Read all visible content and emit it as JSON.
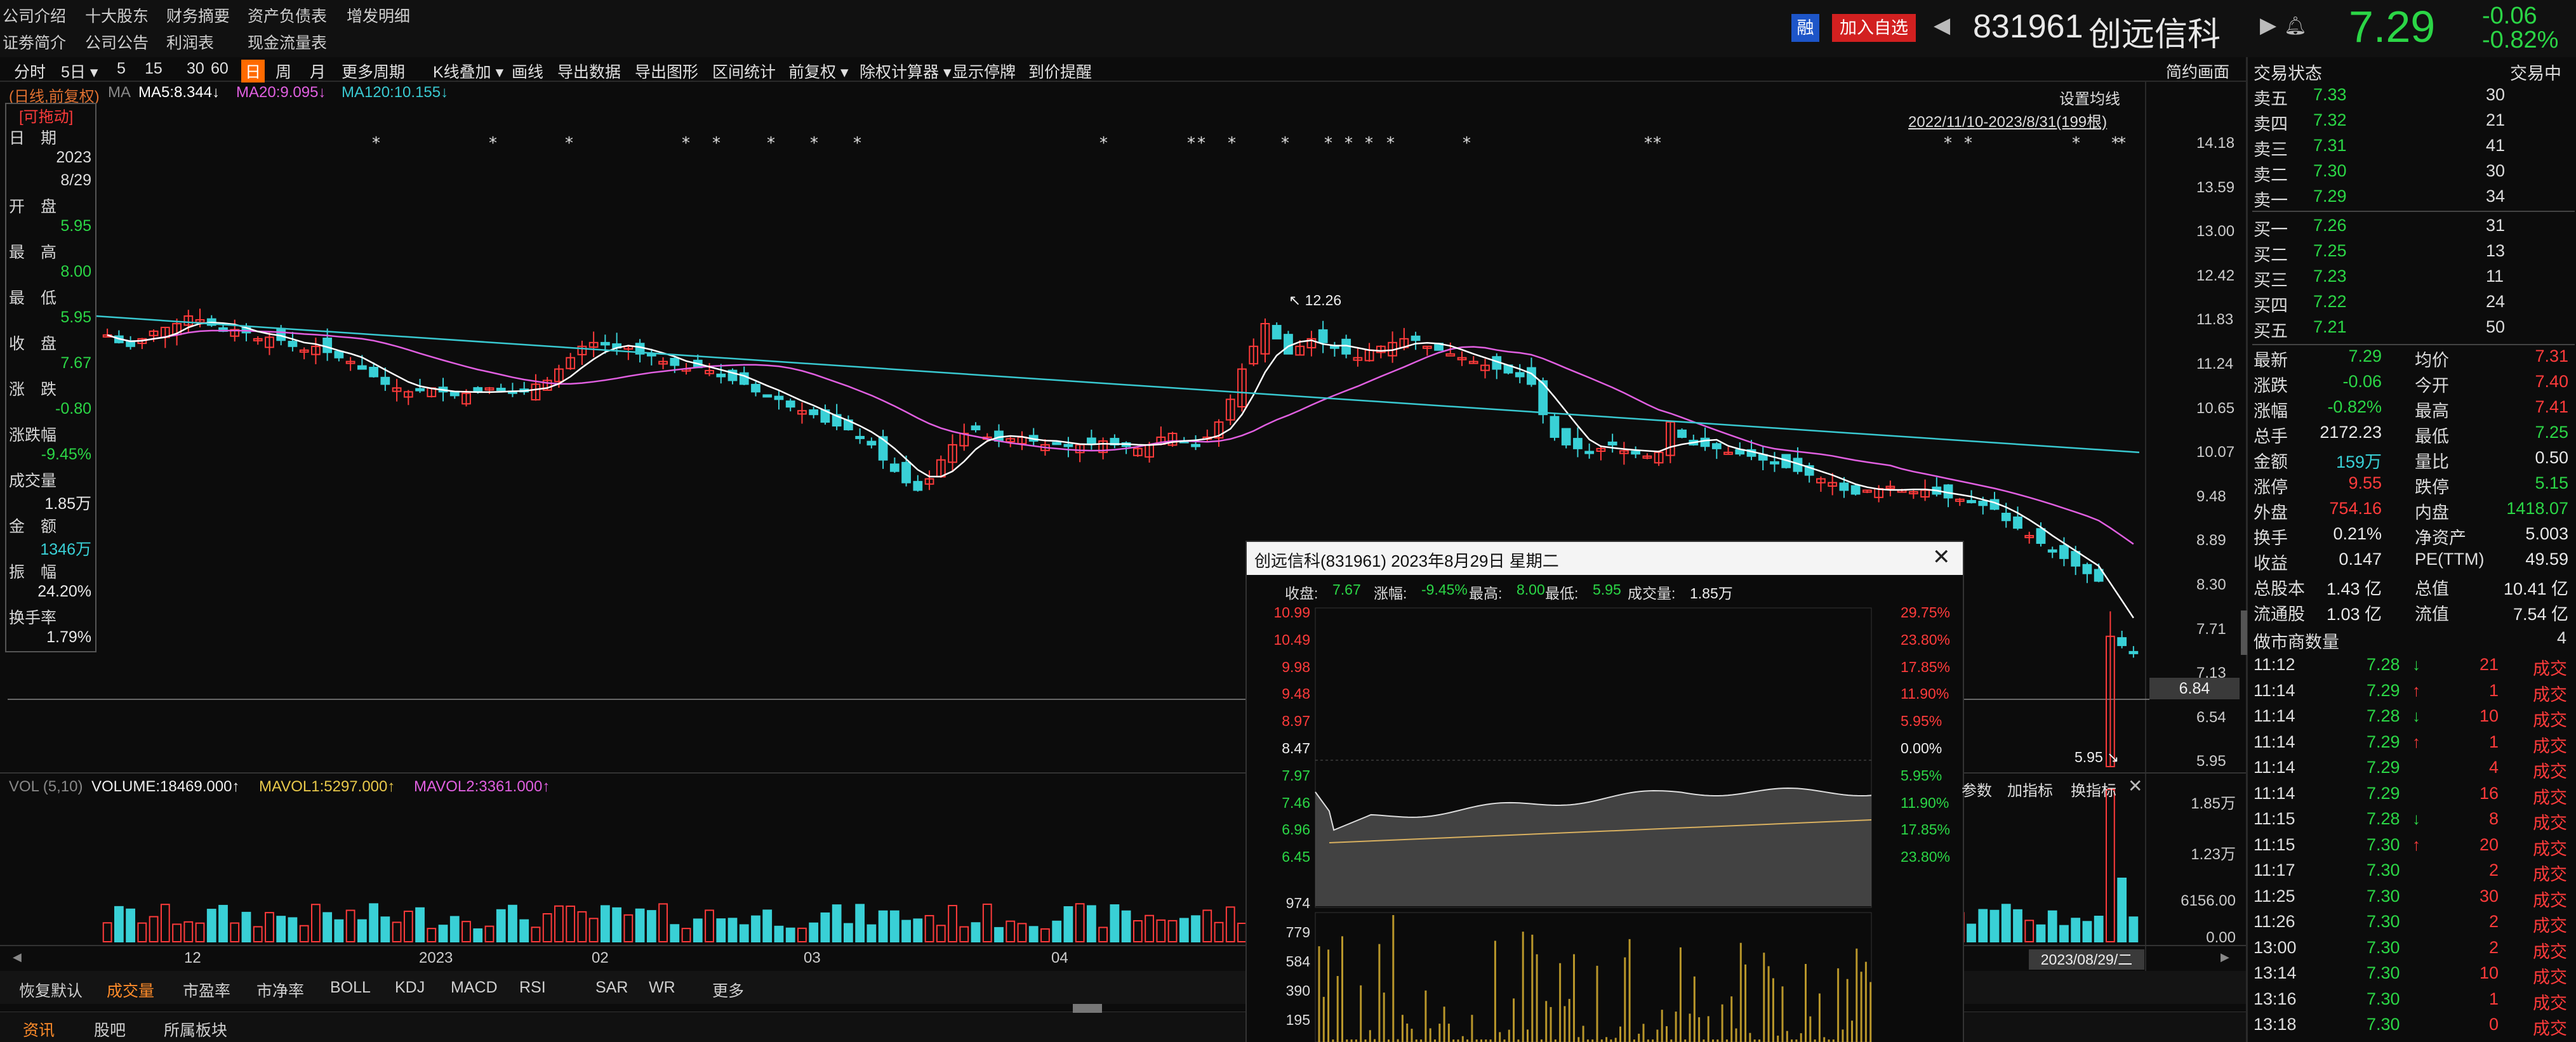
{
  "top_menu": {
    "row1": [
      "公司介绍",
      "十大股东",
      "财务摘要",
      "资产负债表",
      "增发明细"
    ],
    "row2": [
      "证劵简介",
      "公司公告",
      "利润表",
      "现金流量表"
    ]
  },
  "header": {
    "margin_badge": "融",
    "add_watch": "加入自选",
    "code": "831961",
    "name": "创远信科",
    "price": "7.29",
    "change": "-0.06",
    "change_pct": "-0.82%"
  },
  "toolbar": [
    "分时",
    "5日",
    "5",
    "15",
    "30",
    "60",
    "日",
    "周",
    "月",
    "更多周期",
    "K线叠加",
    "画线",
    "导出数据",
    "导出图形",
    "区间统计",
    "前复权",
    "除权计算器",
    "显示停牌",
    "到价提醒"
  ],
  "toolbar_active": "日",
  "simple_mode": "简约画面",
  "chart_header": {
    "mode": "(日线,前复权)",
    "ma_label": "MA",
    "ma5": "MA5:8.344↓",
    "ma20": "MA20:9.095↓",
    "ma120": "MA120:10.155↓",
    "set_ma": "设置均线",
    "range": "2022/11/10-2023/8/31(199根)"
  },
  "info_box": {
    "drag": "[可拖动]",
    "rows": [
      {
        "label": "日　期",
        "value": ""
      },
      {
        "label": "",
        "value": "2023"
      },
      {
        "label": "",
        "value": "8/29"
      },
      {
        "label": "开　盘",
        "value": ""
      },
      {
        "label": "",
        "value": "5.95",
        "color": "green"
      },
      {
        "label": "最　高",
        "value": ""
      },
      {
        "label": "",
        "value": "8.00",
        "color": "green"
      },
      {
        "label": "最　低",
        "value": ""
      },
      {
        "label": "",
        "value": "5.95",
        "color": "green"
      },
      {
        "label": "收　盘",
        "value": ""
      },
      {
        "label": "",
        "value": "7.67",
        "color": "green"
      },
      {
        "label": "涨　跌",
        "value": ""
      },
      {
        "label": "",
        "value": "-0.80",
        "color": "green"
      },
      {
        "label": "涨跌幅",
        "value": ""
      },
      {
        "label": "",
        "value": "-9.45%",
        "color": "green"
      },
      {
        "label": "成交量",
        "value": ""
      },
      {
        "label": "",
        "value": "1.85万",
        "color": "white"
      },
      {
        "label": "金　额",
        "value": ""
      },
      {
        "label": "",
        "value": "1346万",
        "color": "cyan"
      },
      {
        "label": "振　幅",
        "value": ""
      },
      {
        "label": "",
        "value": "24.20%",
        "color": "white"
      },
      {
        "label": "换手率",
        "value": ""
      },
      {
        "label": "",
        "value": "1.79%",
        "color": "white"
      }
    ]
  },
  "price_axis": [
    "14.18",
    "13.59",
    "13.00",
    "12.42",
    "11.83",
    "11.24",
    "10.65",
    "10.07",
    "9.48",
    "8.89",
    "8.30",
    "7.71",
    "7.13",
    "6.54",
    "5.95"
  ],
  "crosshair_price": "6.84",
  "high_label": "12.26",
  "low_label": "5.95",
  "volume_header": {
    "vol": "VOL (5,10)",
    "volume": "VOLUME:18469.000↑",
    "mavol1": "MAVOL1:5297.000↑",
    "mavol2": "MAVOL2:3361.000↑"
  },
  "volume_axis": [
    "1.85万",
    "1.23万",
    "6156.00",
    "0.00"
  ],
  "volume_tools": [
    "参数",
    "加指标",
    "换指标"
  ],
  "x_axis": [
    "12",
    "2023",
    "02",
    "03",
    "04"
  ],
  "date_tag": "2023/08/29/二",
  "indicator_tabs": [
    "恢复默认",
    "成交量",
    "市盈率",
    "市净率",
    "BOLL",
    "KDJ",
    "MACD",
    "RSI",
    "SAR",
    "WR",
    "更多"
  ],
  "indicator_active": "成交量",
  "bottom_tabs": [
    "资讯",
    "股吧",
    "所属板块"
  ],
  "popup": {
    "title": "创远信科(831961)  2023年8月29日  星期二",
    "summary": [
      {
        "label": "收盘:",
        "value": "7.67"
      },
      {
        "label": "涨幅:",
        "value": "-9.45%"
      },
      {
        "label": "最高:",
        "value": "8.00"
      },
      {
        "label": "最低:",
        "value": "5.95"
      },
      {
        "label": "成交量:",
        "value": "1.85万"
      }
    ],
    "left_prices": [
      "10.99",
      "10.49",
      "9.98",
      "9.48",
      "8.97",
      "8.47",
      "7.97",
      "7.46",
      "6.96",
      "6.45"
    ],
    "right_pcts": [
      "29.75%",
      "23.80%",
      "17.85%",
      "11.90%",
      "5.95%",
      "0.00%",
      "5.95%",
      "11.90%",
      "17.85%",
      "23.80%"
    ],
    "vol_axis": [
      "974",
      "779",
      "584",
      "390",
      "195"
    ]
  },
  "right_panel": {
    "status_label": "交易状态",
    "status_value": "交易中",
    "asks": [
      {
        "label": "卖五",
        "price": "7.33",
        "vol": "30"
      },
      {
        "label": "卖四",
        "price": "7.32",
        "vol": "21"
      },
      {
        "label": "卖三",
        "price": "7.31",
        "vol": "41"
      },
      {
        "label": "卖二",
        "price": "7.30",
        "vol": "30"
      },
      {
        "label": "卖一",
        "price": "7.29",
        "vol": "34"
      }
    ],
    "bids": [
      {
        "label": "买一",
        "price": "7.26",
        "vol": "31"
      },
      {
        "label": "买二",
        "price": "7.25",
        "vol": "13"
      },
      {
        "label": "买三",
        "price": "7.23",
        "vol": "11"
      },
      {
        "label": "买四",
        "price": "7.22",
        "vol": "24"
      },
      {
        "label": "买五",
        "price": "7.21",
        "vol": "50"
      }
    ],
    "stats": [
      {
        "l1": "最新",
        "v1": "7.29",
        "c1": "green",
        "l2": "均价",
        "v2": "7.31",
        "c2": "red"
      },
      {
        "l1": "涨跌",
        "v1": "-0.06",
        "c1": "green",
        "l2": "今开",
        "v2": "7.40",
        "c2": "red"
      },
      {
        "l1": "涨幅",
        "v1": "-0.82%",
        "c1": "green",
        "l2": "最高",
        "v2": "7.41",
        "c2": "red"
      },
      {
        "l1": "总手",
        "v1": "2172.23",
        "c1": "white",
        "l2": "最低",
        "v2": "7.25",
        "c2": "green"
      },
      {
        "l1": "金额",
        "v1": "159万",
        "c1": "cyan",
        "l2": "量比",
        "v2": "0.50",
        "c2": "white"
      },
      {
        "l1": "涨停",
        "v1": "9.55",
        "c1": "red",
        "l2": "跌停",
        "v2": "5.15",
        "c2": "green"
      },
      {
        "l1": "外盘",
        "v1": "754.16",
        "c1": "red",
        "l2": "内盘",
        "v2": "1418.07",
        "c2": "green"
      },
      {
        "l1": "换手",
        "v1": "0.21%",
        "c1": "white",
        "l2": "净资产",
        "v2": "5.003",
        "c2": "white"
      },
      {
        "l1": "收益",
        "v1": "0.147",
        "c1": "white",
        "l2": "PE(TTM)",
        "v2": "49.59",
        "c2": "white"
      },
      {
        "l1": "总股本",
        "v1": "1.43 亿",
        "c1": "white",
        "l2": "总值",
        "v2": "10.41 亿",
        "c2": "white"
      },
      {
        "l1": "流通股",
        "v1": "1.03 亿",
        "c1": "white",
        "l2": "流值",
        "v2": "7.54 亿",
        "c2": "white"
      }
    ],
    "mm_label": "做市商数量",
    "mm_value": "4",
    "ticks": [
      {
        "time": "11:12",
        "price": "7.28",
        "dir": "down",
        "vol": "21",
        "type": "成交"
      },
      {
        "time": "11:14",
        "price": "7.29",
        "dir": "up",
        "vol": "1",
        "type": "成交"
      },
      {
        "time": "11:14",
        "price": "7.28",
        "dir": "down",
        "vol": "10",
        "type": "成交"
      },
      {
        "time": "11:14",
        "price": "7.29",
        "dir": "up",
        "vol": "1",
        "type": "成交"
      },
      {
        "time": "11:14",
        "price": "7.29",
        "dir": "",
        "vol": "4",
        "type": "成交"
      },
      {
        "time": "11:14",
        "price": "7.29",
        "dir": "",
        "vol": "16",
        "type": "成交"
      },
      {
        "time": "11:15",
        "price": "7.28",
        "dir": "down",
        "vol": "8",
        "type": "成交"
      },
      {
        "time": "11:15",
        "price": "7.30",
        "dir": "up",
        "vol": "20",
        "type": "成交"
      },
      {
        "time": "11:17",
        "price": "7.30",
        "dir": "",
        "vol": "2",
        "type": "成交"
      },
      {
        "time": "11:25",
        "price": "7.30",
        "dir": "",
        "vol": "30",
        "type": "成交"
      },
      {
        "time": "11:26",
        "price": "7.30",
        "dir": "",
        "vol": "2",
        "type": "成交"
      },
      {
        "time": "13:00",
        "price": "7.30",
        "dir": "",
        "vol": "2",
        "type": "成交"
      },
      {
        "time": "13:14",
        "price": "7.30",
        "dir": "",
        "vol": "10",
        "type": "成交"
      },
      {
        "time": "13:16",
        "price": "7.30",
        "dir": "",
        "vol": "1",
        "type": "成交"
      },
      {
        "time": "13:18",
        "price": "7.30",
        "dir": "",
        "vol": "0",
        "type": "成交"
      }
    ]
  },
  "colors": {
    "up": "#ff3b3b",
    "down": "#39d0d6",
    "ma5": "#ffffff",
    "ma20": "#e05fe0",
    "ma120": "#39c8d0",
    "accent": "#ff6a00"
  },
  "chart_data": {
    "type": "candlestick",
    "date_range": [
      "2022/11/10",
      "2023/8/31"
    ],
    "bars": 199,
    "ylim": [
      5.95,
      14.18
    ],
    "ma": {
      "MA5": 8.344,
      "MA20": 9.095,
      "MA120": 10.155
    },
    "highlight_high": 12.26,
    "highlight_low": 5.95,
    "last_day": {
      "date": "2023/8/29",
      "open": 5.95,
      "high": 8.0,
      "low": 5.95,
      "close": 7.67,
      "volume": 18469
    },
    "closes": [
      11.65,
      11.55,
      11.5,
      11.6,
      11.7,
      11.75,
      11.8,
      11.9,
      11.85,
      11.78,
      11.7,
      11.72,
      11.68,
      11.6,
      11.62,
      11.58,
      11.5,
      11.45,
      11.5,
      11.42,
      11.35,
      11.3,
      11.2,
      11.1,
      11.0,
      10.95,
      10.9,
      10.92,
      10.95,
      10.9,
      10.85,
      10.88,
      10.9,
      10.95,
      10.92,
      10.88,
      10.9,
      11.0,
      11.05,
      11.2,
      11.35,
      11.5,
      11.55,
      11.52,
      11.48,
      11.5,
      11.4,
      11.38,
      11.3,
      11.25,
      11.2,
      11.22,
      11.18,
      11.1,
      11.05,
      11.0,
      10.9,
      10.85,
      10.8,
      10.7,
      10.65,
      10.6,
      10.5,
      10.45,
      10.4,
      10.3,
      10.2,
      10.0,
      9.85,
      9.7,
      9.6,
      9.75,
      10.0,
      10.2,
      10.35,
      10.4,
      10.3,
      10.25,
      10.28,
      10.3,
      10.25,
      10.2,
      10.22,
      10.18,
      10.2,
      10.22,
      10.25,
      10.2,
      10.18,
      10.15,
      10.2,
      10.3,
      10.35,
      10.25,
      10.2,
      10.3,
      10.5,
      10.8,
      11.2,
      11.5,
      11.8,
      11.6,
      11.4,
      11.5,
      11.6,
      11.55,
      11.5,
      11.4,
      11.35,
      11.45,
      11.5,
      11.55,
      11.6,
      11.58,
      11.5,
      11.45,
      11.4,
      11.35,
      11.3,
      11.25,
      11.2,
      11.15,
      11.1,
      11.0,
      10.6,
      10.3,
      10.2,
      10.15,
      10.1,
      10.15,
      10.2,
      10.12,
      10.08,
      10.05,
      10.1,
      10.5,
      10.3,
      10.2,
      10.18,
      10.15,
      10.1,
      10.08,
      10.05,
      10.0,
      9.95,
      9.9,
      9.85,
      9.8,
      9.75,
      9.7,
      9.6,
      9.55,
      9.6,
      9.62,
      9.65,
      9.6,
      9.58,
      9.6,
      9.55,
      9.5,
      9.48,
      9.45,
      9.4,
      9.35,
      9.2,
      9.1,
      9.0,
      8.9,
      8.8,
      8.7,
      8.6,
      8.5,
      8.4,
      7.67,
      7.55,
      7.45
    ]
  }
}
